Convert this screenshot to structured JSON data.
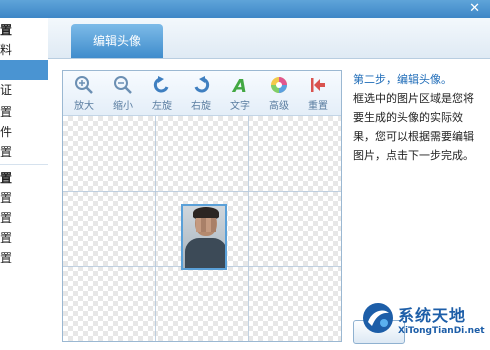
{
  "window": {
    "close_glyph": "✕"
  },
  "sidebar": {
    "items": [
      {
        "label": "置",
        "bold": true
      },
      {
        "label": "料",
        "bold": false
      },
      {
        "label": "",
        "selected": true
      },
      {
        "label": "证",
        "bold": false
      },
      {
        "label": "置",
        "bold": false
      },
      {
        "label": "件",
        "bold": false
      },
      {
        "label": "置",
        "bold": false
      },
      {
        "label": "置",
        "bold": true
      },
      {
        "label": "置",
        "bold": false
      },
      {
        "label": "置",
        "bold": false
      },
      {
        "label": "置",
        "bold": false
      },
      {
        "label": "置",
        "bold": false
      }
    ]
  },
  "tabs": [
    {
      "label": "编辑头像"
    }
  ],
  "toolbar": {
    "tools": [
      {
        "label": "放大",
        "icon": "zoom-in-icon"
      },
      {
        "label": "缩小",
        "icon": "zoom-out-icon"
      },
      {
        "label": "左旋",
        "icon": "rotate-left-icon"
      },
      {
        "label": "右旋",
        "icon": "rotate-right-icon"
      },
      {
        "label": "文字",
        "icon": "text-icon"
      },
      {
        "label": "高级",
        "icon": "advanced-color-icon"
      },
      {
        "label": "重置",
        "icon": "reset-icon"
      }
    ]
  },
  "info": {
    "step_title": "第二步，编辑头像。",
    "description": "框选中的图片区域是您将要生成的头像的实际效果，您可以根据需要编辑图片，点击下一步完成。"
  },
  "watermark": {
    "title": "系统天地",
    "subtitle": "XiTongTianDi.net"
  },
  "colors": {
    "accent": "#4a94d2",
    "step_text": "#1f6cb8",
    "tool_label": "#5a7da0"
  }
}
